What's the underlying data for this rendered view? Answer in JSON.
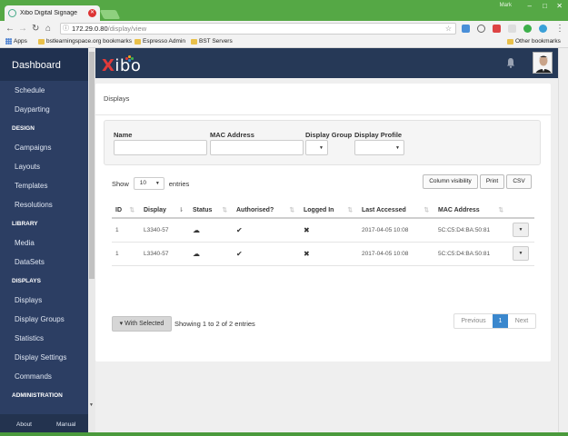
{
  "browser": {
    "tab_title": "Xibo Digital Signage",
    "window_user": "Mark",
    "url_host": "172.29.0.80",
    "url_path": "/display/view",
    "bookmarks": {
      "apps": "Apps",
      "items": [
        "bstlearningspace.org bookmarks",
        "Espresso Admin",
        "BST Servers"
      ],
      "other": "Other bookmarks"
    }
  },
  "sidebar": {
    "brand": "Dashboard",
    "schedule": "Schedule",
    "dayparting": "Dayparting",
    "design_head": "DESIGN",
    "campaigns": "Campaigns",
    "layouts": "Layouts",
    "templates": "Templates",
    "resolutions": "Resolutions",
    "library_head": "LIBRARY",
    "media": "Media",
    "datasets": "DataSets",
    "displays_head": "DISPLAYS",
    "displays": "Displays",
    "display_groups": "Display Groups",
    "statistics": "Statistics",
    "display_settings": "Display Settings",
    "commands": "Commands",
    "admin_head": "ADMINISTRATION",
    "about": "About",
    "manual": "Manual"
  },
  "header": {
    "logo_x": "X",
    "logo_rest": "ibo"
  },
  "page": {
    "breadcrumb": "Displays",
    "filters": {
      "name_label": "Name",
      "mac_label": "MAC Address",
      "display_group_label": "Display Group",
      "display_profile_label": "Display Profile"
    },
    "show_label": "Show",
    "page_size": "10",
    "entries_label": "entries",
    "buttons": {
      "column_visibility": "Column visibility",
      "print": "Print",
      "csv": "CSV"
    },
    "table": {
      "headers": [
        "ID",
        "Display",
        "Status",
        "Authorised?",
        "Logged In",
        "Last Accessed",
        "MAC Address"
      ],
      "rows": [
        {
          "id": "1",
          "display": "L3340-57",
          "last_accessed": "2017-04-05 10:08",
          "mac": "5C:C5:D4:BA:50:81"
        },
        {
          "id": "1",
          "display": "L3340-57",
          "last_accessed": "2017-04-05 10:08",
          "mac": "5C:C5:D4:BA:50:81"
        }
      ]
    },
    "with_selected": "▾ With Selected",
    "info": "Showing 1 to 2 of 2 entries",
    "pager": {
      "previous": "Previous",
      "current": "1",
      "next": "Next"
    }
  },
  "colors": {
    "sidebar": "#2c3e63",
    "topbar": "#263957",
    "accent": "#3a87cd",
    "browser_frame": "#55a845"
  }
}
